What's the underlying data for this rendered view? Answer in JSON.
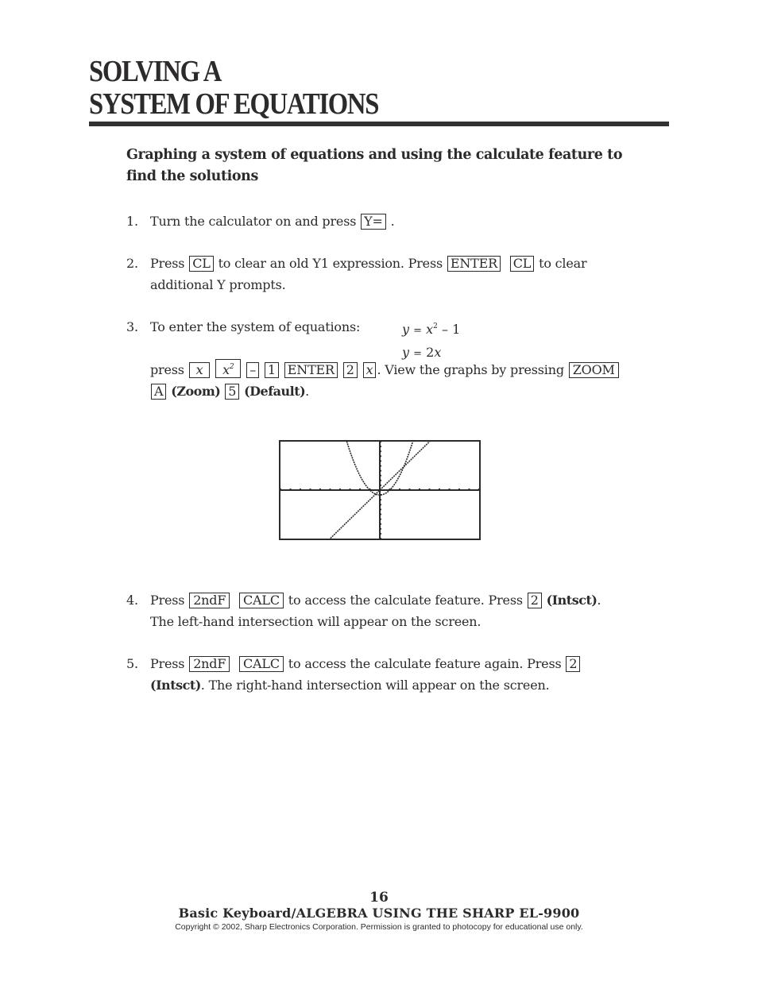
{
  "header": {
    "title_line1": "SOLVING A",
    "title_line2": "SYSTEM OF EQUATIONS"
  },
  "subheading": "Graphing a system of equations and using the calculate feature to find the solutions",
  "steps": [
    {
      "number": "1.",
      "text_before": "Turn the calculator on and press",
      "key": "Y=",
      "text_after": "."
    },
    {
      "number": "2.",
      "text_a": "Press",
      "key1": "CL",
      "text_b": "to clear an old Y1 expression.  Press",
      "key2": "ENTER",
      "key3": "CL",
      "text_c": "to clear",
      "line2": "additional Y prompts."
    },
    {
      "number": "3.",
      "intro": "To enter the system of equations:",
      "equations": [
        {
          "lhs": "y",
          "rhs_var": "x",
          "exp": "2",
          "rest": "– 1"
        },
        {
          "lhs": "y",
          "coef": "2",
          "rhs_var": "x"
        }
      ],
      "press_label": "press",
      "keys": [
        "x",
        "x2",
        "–",
        "1",
        "ENTER",
        "2",
        "x"
      ],
      "text_view": ".  View the graphs by pressing",
      "zoom_key": "ZOOM",
      "a_key": "A",
      "zoom_label": "(Zoom)",
      "five_key": "5",
      "default_label": "(Default)",
      "end": "."
    },
    {
      "number": "4.",
      "text_a": "Press",
      "key1": "2ndF",
      "key2": "CALC",
      "text_b": "to access the calculate feature.  Press",
      "key3": "2",
      "bold": "(Intsct)",
      "end": ".",
      "line2": "The left-hand intersection will appear on the screen."
    },
    {
      "number": "5.",
      "text_a": "Press",
      "key1": "2ndF",
      "key2": "CALC",
      "text_b": "to access the calculate feature again.  Press",
      "key3": "2",
      "bold": "(Intsct)",
      "line2_rest": ".  The right-hand intersection will appear on the screen."
    }
  ],
  "chart_data": {
    "type": "line",
    "title": "",
    "xlabel": "",
    "ylabel": "",
    "xlim": [
      -10,
      10
    ],
    "ylim": [
      -10,
      10
    ],
    "x_tick_step": 1,
    "y_tick_step": 1,
    "grid": false,
    "series": [
      {
        "name": "y = x^2 - 1",
        "expr": "x^2-1"
      },
      {
        "name": "y = 2x",
        "expr": "2x"
      }
    ]
  },
  "footer": {
    "page_number": "16",
    "book_title": "Basic Keyboard/ALGEBRA USING THE SHARP EL-9900",
    "copyright": "Copyright © 2002, Sharp Electronics Corporation.  Permission is granted to photocopy for educational use only."
  }
}
